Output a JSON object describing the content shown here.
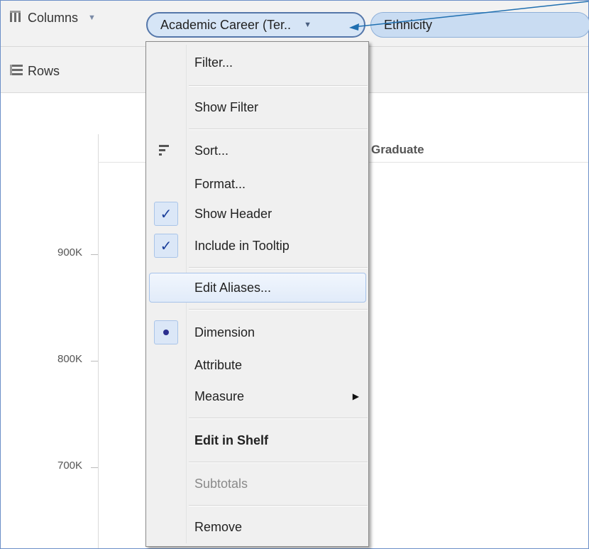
{
  "shelves": {
    "columns_label": "Columns",
    "rows_label": "Rows",
    "columns_icon": "columns-grid-icon",
    "rows_icon": "rows-list-icon"
  },
  "pills": {
    "academic_career": "Academic Career (Ter..",
    "ethnicity": "Ethnicity"
  },
  "chart": {
    "column_header": "Graduate",
    "y_ticks": [
      "900K",
      "800K",
      "700K"
    ]
  },
  "menu": {
    "filter": "Filter...",
    "show_filter": "Show Filter",
    "sort": "Sort...",
    "format": "Format...",
    "show_header": "Show Header",
    "include_in_tooltip": "Include in Tooltip",
    "edit_aliases": "Edit Aliases...",
    "dimension": "Dimension",
    "attribute": "Attribute",
    "measure": "Measure",
    "edit_in_shelf": "Edit in Shelf",
    "subtotals": "Subtotals",
    "remove": "Remove",
    "checked_items": [
      "Show Header",
      "Include in Tooltip"
    ],
    "selected_role": "Dimension",
    "highlighted_item": "Edit Aliases...",
    "disabled_items": [
      "Subtotals"
    ]
  },
  "colors": {
    "pill_fill": "#c9dcf2",
    "pill_border": "#5577aa",
    "check": "#1a3e9a",
    "highlight": "#e1ebf9"
  }
}
